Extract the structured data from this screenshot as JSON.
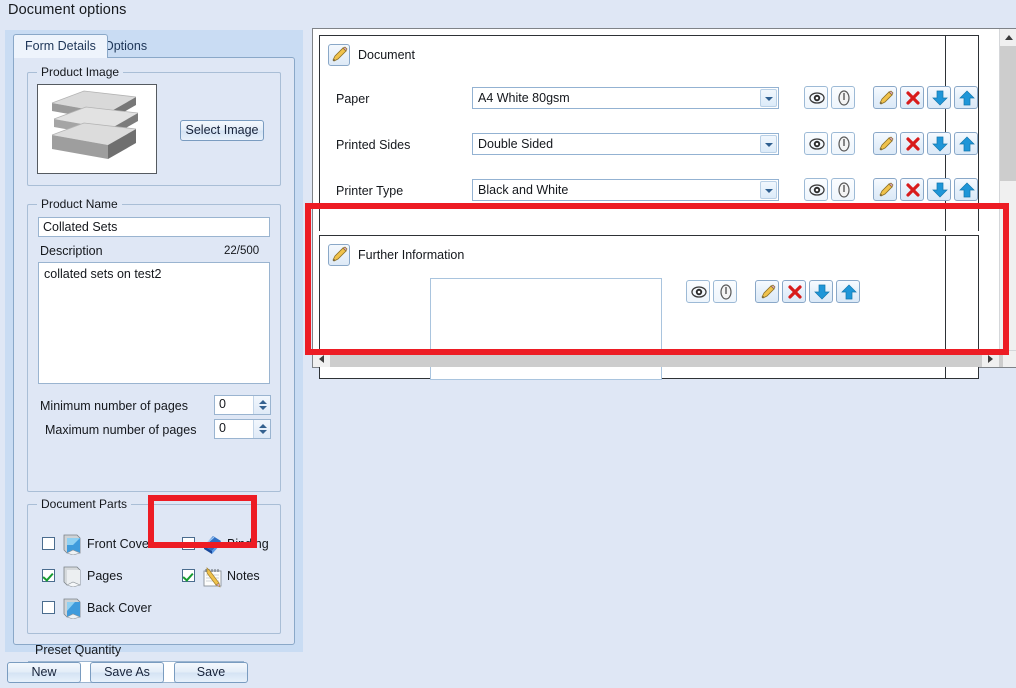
{
  "window": {
    "title": "Document options"
  },
  "tabs": [
    {
      "label": "Form Details",
      "active": true
    },
    {
      "label": "Options",
      "active": false
    }
  ],
  "left": {
    "product_image": {
      "group_title": "Product Image",
      "select_button": "Select Image",
      "thumbnail_icon": "stacked-paper-image"
    },
    "product_name": {
      "group_title": "Product Name",
      "name_value": "Collated Sets",
      "description_label": "Description",
      "char_count": "22/500",
      "description_value": "collated sets on test2",
      "min_pages_label": "Minimum number of pages",
      "min_pages_value": "0",
      "max_pages_label": "Maximum number of pages",
      "max_pages_value": "0"
    },
    "document_parts": {
      "group_title": "Document Parts",
      "items": [
        {
          "label": "Front Cover",
          "checked": false,
          "icon": "book-cover-icon"
        },
        {
          "label": "Binding",
          "checked": false,
          "icon": "binding-icon"
        },
        {
          "label": "Pages",
          "checked": true,
          "icon": "pages-icon"
        },
        {
          "label": "Notes",
          "checked": true,
          "icon": "notes-pencil-icon"
        },
        {
          "label": "Back Cover",
          "checked": false,
          "icon": "book-back-icon"
        }
      ]
    },
    "preset_quantity": {
      "label": "Preset Quantity",
      "value": ""
    },
    "buttons": {
      "new": "New",
      "save_as": "Save As",
      "save": "Save"
    }
  },
  "right": {
    "sections": [
      {
        "title": "Document",
        "rows": [
          {
            "label": "Paper",
            "value": "A4 White 80gsm"
          },
          {
            "label": "Printed Sides",
            "value": "Double Sided"
          },
          {
            "label": "Printer Type",
            "value": "Black and White"
          }
        ]
      },
      {
        "title": "Further Information",
        "rows": [
          {
            "label": "",
            "value": ""
          }
        ]
      }
    ],
    "row_actions": [
      {
        "name": "view-icon",
        "tip": "View"
      },
      {
        "name": "info-icon",
        "tip": "Info"
      },
      {
        "name": "edit-icon",
        "tip": "Edit"
      },
      {
        "name": "delete-icon",
        "tip": "Delete"
      },
      {
        "name": "move-down-icon",
        "tip": "Move Down"
      },
      {
        "name": "move-up-icon",
        "tip": "Move Up"
      }
    ]
  },
  "highlights": [
    {
      "name": "notes-highlight",
      "color": "#ed1c24"
    },
    {
      "name": "further-information-highlight",
      "color": "#ed1c24"
    }
  ]
}
